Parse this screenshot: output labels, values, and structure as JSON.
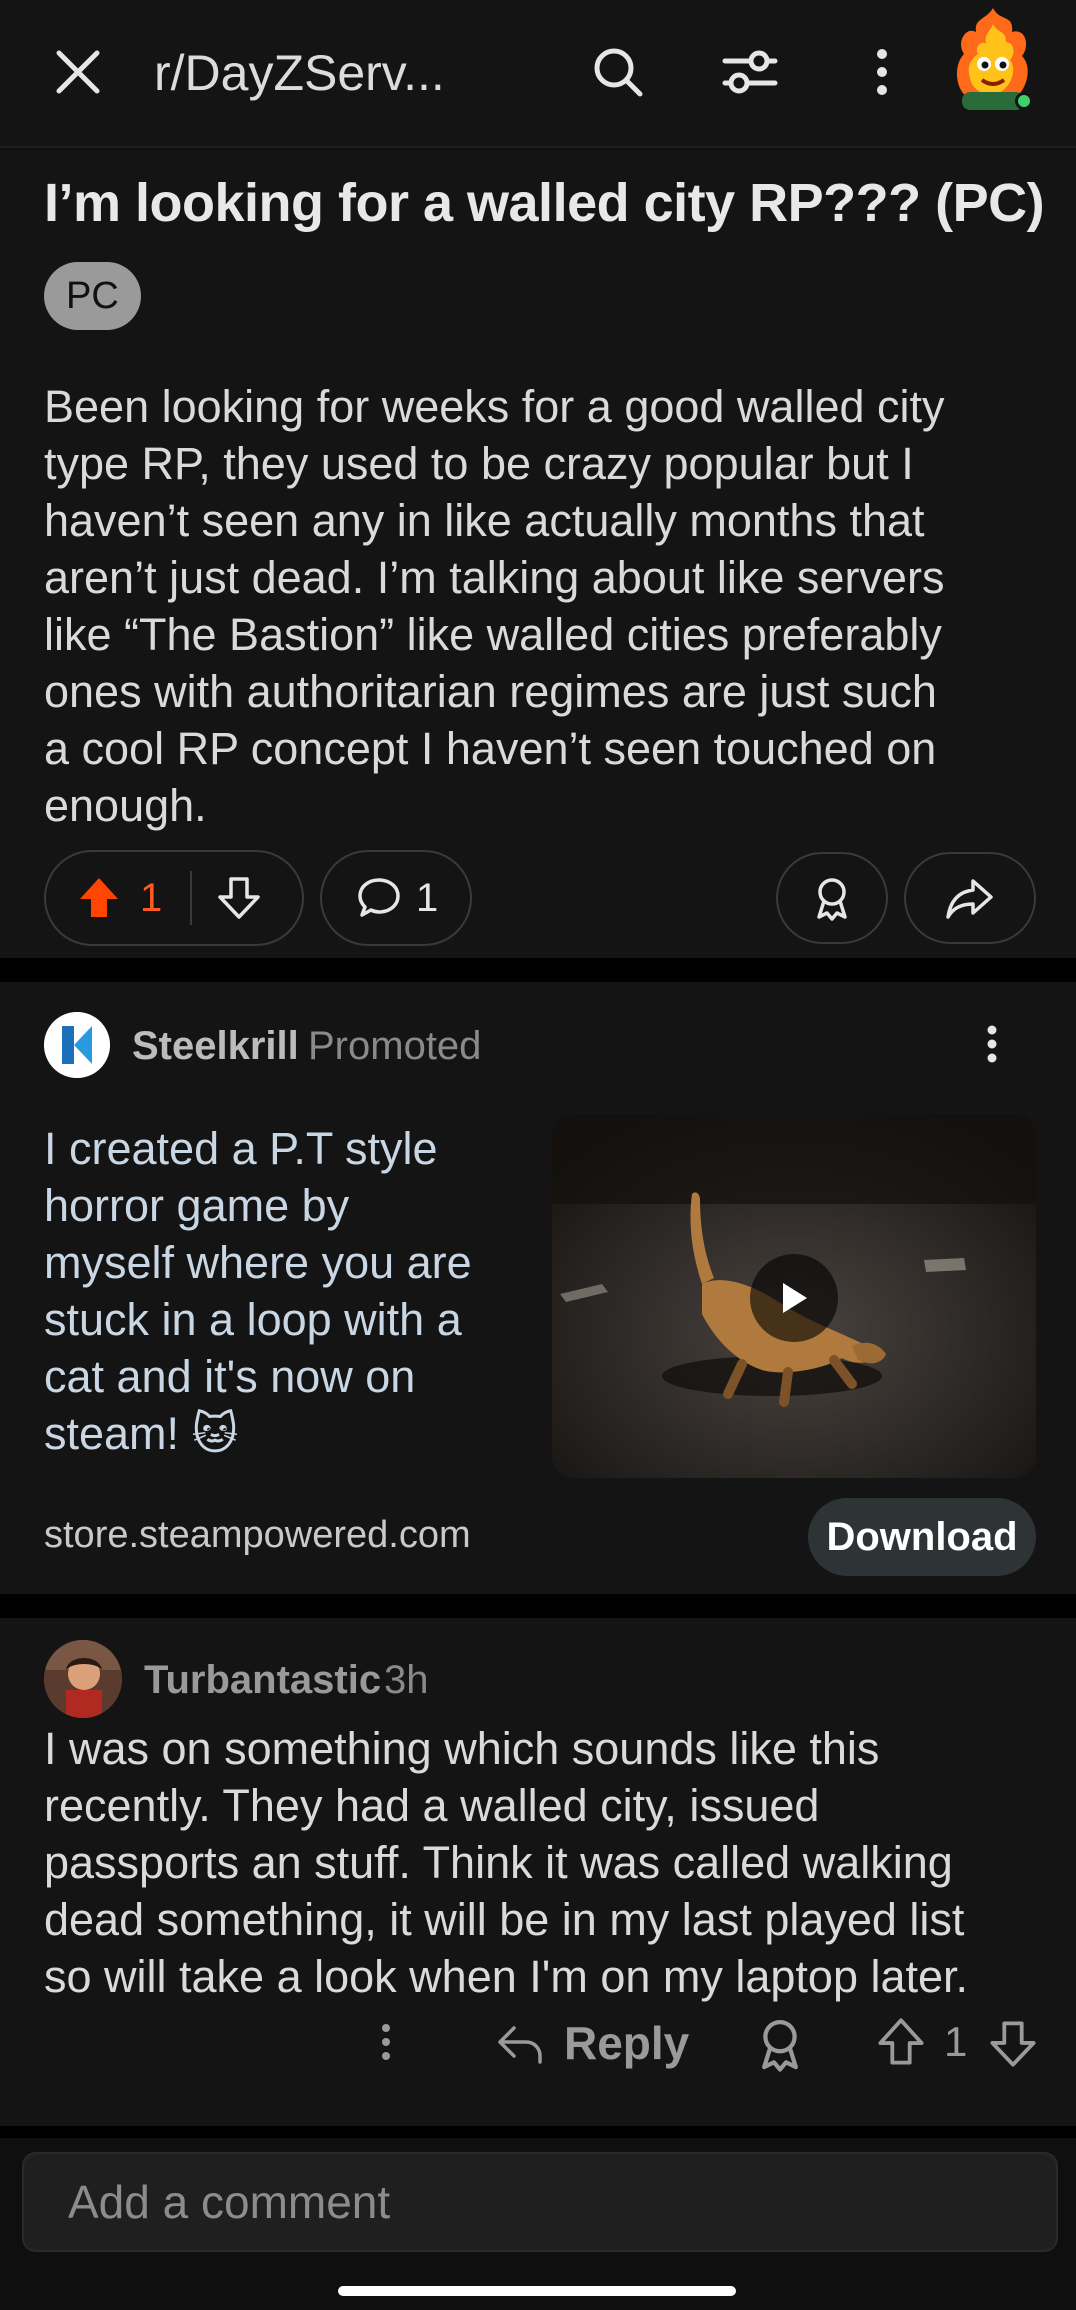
{
  "header": {
    "title": "r/DayZServ...",
    "icons": [
      "close-icon",
      "search-icon",
      "filter-icon",
      "more-vertical-icon",
      "avatar"
    ]
  },
  "post": {
    "title": "I’m looking for a walled city RP??? (PC)",
    "flair": "PC",
    "body_lines": [
      "Been looking for weeks for a good walled city",
      "type RP, they used to be crazy popular but I",
      "haven’t seen any in like actually months that",
      "aren’t just dead. I’m talking about like servers",
      "like “The Bastion” like walled cities preferably",
      "ones with authoritarian regimes are just such",
      "a cool RP concept I haven’t seen touched on",
      "enough."
    ],
    "upvotes": "1",
    "comments": "1",
    "upvote_color": "#ff4500"
  },
  "ad": {
    "advertiser": "Steelkrill",
    "promoted": "Promoted",
    "text_lines": [
      "I created a P.T style",
      "horror game by",
      "myself where you are",
      "stuck in a loop with a",
      "cat and it's now on",
      "steam! 🐱"
    ],
    "domain": "store.steampowered.com",
    "cta": "Download"
  },
  "comment": {
    "author": "Turbantastic",
    "time": "3h",
    "body_lines": [
      "I was on something which sounds like this",
      "recently. They had a walled city, issued",
      "passports an stuff. Think it was called walking",
      "dead something, it will be in my last played list",
      "so will take a look when I'm on my laptop later."
    ],
    "reply_label": "Reply",
    "votes": "1"
  },
  "composer": {
    "placeholder": "Add a comment"
  }
}
